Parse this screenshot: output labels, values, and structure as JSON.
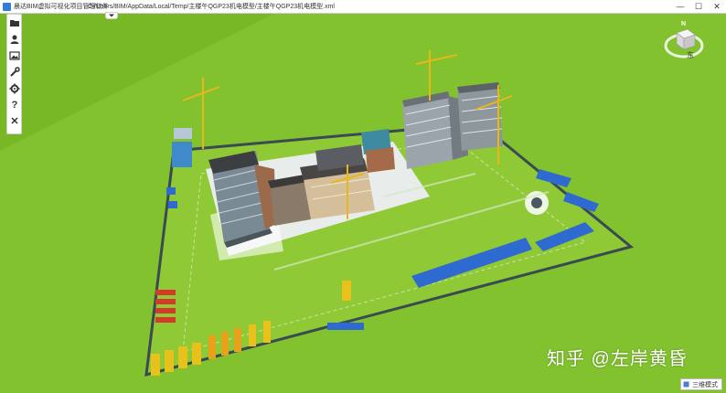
{
  "window": {
    "app_title": "晨达BIM虚拟可视化项目管理软件",
    "file_path": "C:/Users/BIM/AppData/Local/Temp/主楼午QGP23机电模型/主楼午QGP23机电模型.xml",
    "minimize_glyph": "—",
    "maximize_glyph": "☐",
    "close_glyph": "✕"
  },
  "toolbar": {
    "tools": [
      {
        "icon": "folder-icon"
      },
      {
        "icon": "person-icon"
      },
      {
        "icon": "image-icon"
      },
      {
        "icon": "wrench-icon"
      },
      {
        "icon": "gear-icon"
      },
      {
        "icon": "help-icon",
        "glyph": "?"
      },
      {
        "icon": "close-icon",
        "glyph": "✕"
      }
    ]
  },
  "view_cube": {
    "face_label": "东",
    "compass_label": "N"
  },
  "watermark": "知乎 @左岸黄昏",
  "view_mode": {
    "label": "三维模式"
  },
  "colors": {
    "grass": "#7fbf2a",
    "site_pad": "#9ccf3c",
    "road_blue": "#2f6ad0",
    "crane_yellow": "#e8b81a"
  }
}
